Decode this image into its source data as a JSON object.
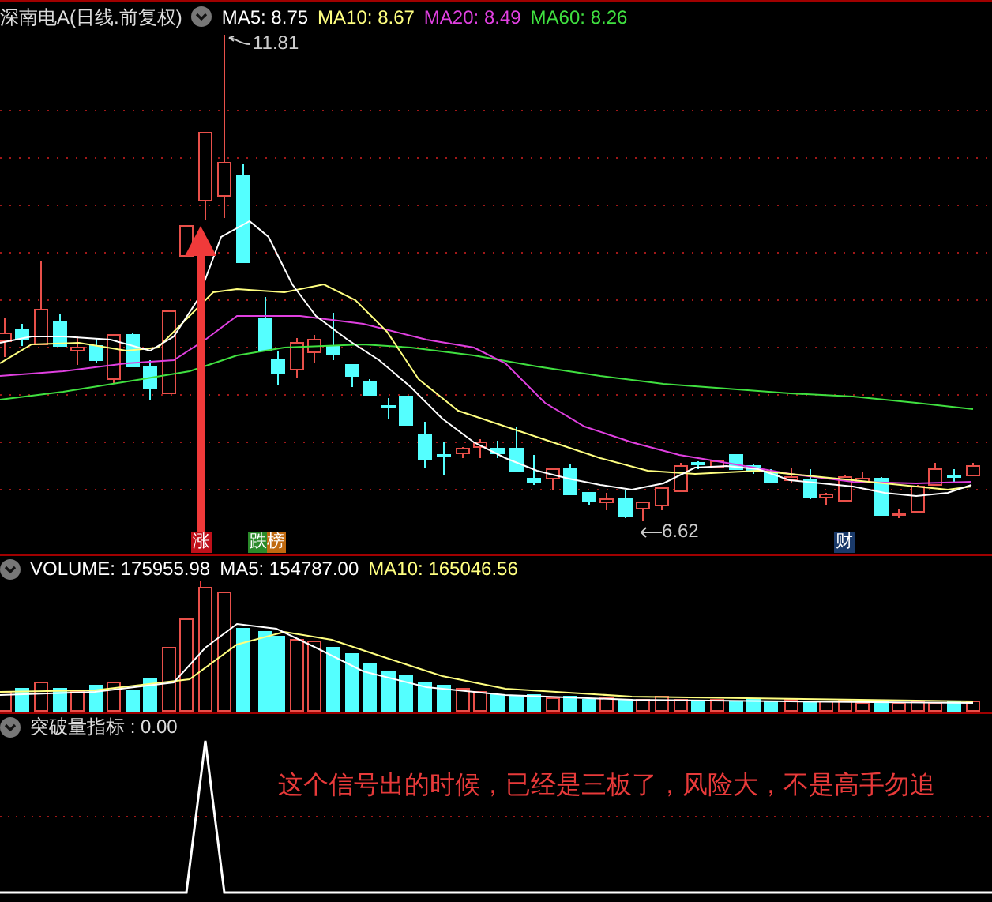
{
  "price_panel": {
    "title": "深南电A(日线.前复权)",
    "indicators": [
      {
        "label": "MA5: 8.75",
        "color": "#ffffff"
      },
      {
        "label": "MA10: 8.67",
        "color": "#ffff80"
      },
      {
        "label": "MA20: 8.49",
        "color": "#e040e0"
      },
      {
        "label": "MA60: 8.26",
        "color": "#40e040"
      }
    ],
    "high_label": "11.81",
    "low_label": "6.62",
    "markers": [
      {
        "text": "涨",
        "kind": "rise"
      },
      {
        "text": "跌榜",
        "kind": "board"
      },
      {
        "text": "财",
        "kind": "finance"
      }
    ]
  },
  "volume_panel": {
    "indicators": [
      {
        "label": "VOLUME: 175955.98",
        "color": "#ffffff"
      },
      {
        "label": "MA5: 154787.00",
        "color": "#ffffff"
      },
      {
        "label": "MA10: 165046.56",
        "color": "#ffff80"
      }
    ]
  },
  "signal_panel": {
    "title": "突破量指标 : 0.00",
    "note": "这个信号出的时候，已经是三板了，风险大，不是高手勿追"
  }
}
